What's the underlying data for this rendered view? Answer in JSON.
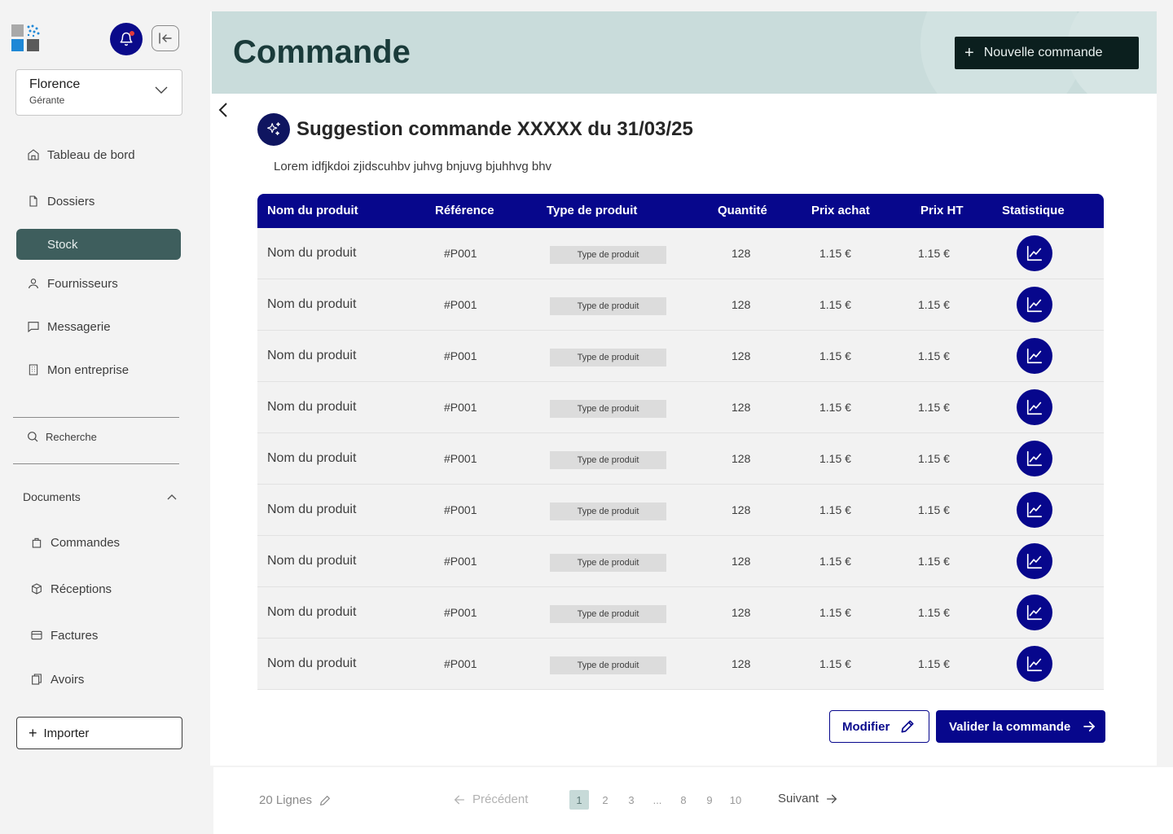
{
  "sidebar": {
    "user": {
      "name": "Florence",
      "role": "Gérante"
    },
    "nav": [
      {
        "label": "Tableau de bord",
        "icon": "home-icon"
      },
      {
        "label": "Dossiers",
        "icon": "file-icon"
      },
      {
        "label": "Stock",
        "icon": "stock-icon"
      },
      {
        "label": "Fournisseurs",
        "icon": "user-icon"
      },
      {
        "label": "Messagerie",
        "icon": "message-icon"
      },
      {
        "label": "Mon entreprise",
        "icon": "building-icon"
      }
    ],
    "active_index": 2,
    "search_label": "Recherche",
    "documents": {
      "label": "Documents",
      "items": [
        {
          "label": "Commandes",
          "icon": "bag-icon"
        },
        {
          "label": "Réceptions",
          "icon": "package-icon"
        },
        {
          "label": "Factures",
          "icon": "invoice-icon"
        },
        {
          "label": "Avoirs",
          "icon": "credit-note-icon"
        }
      ]
    },
    "import_label": "Importer"
  },
  "header": {
    "title": "Commande",
    "new_order_label": "Nouvelle commande"
  },
  "suggestion": {
    "title": "Suggestion commande XXXXX du 31/03/25",
    "description": "Lorem idfjkdoi zjidscuhbv juhvg bnjuvg bjuhhvg bhv"
  },
  "table": {
    "columns": [
      "Nom du produit",
      "Référence",
      "Type de produit",
      "Quantité",
      "Prix achat",
      "Prix HT",
      "Statistique"
    ],
    "rows": [
      {
        "name": "Nom du produit",
        "ref": "#P001",
        "type": "Type de produit",
        "qty": "128",
        "prix_achat": "1.15 €",
        "prix_ht": "1.15 €"
      },
      {
        "name": "Nom du produit",
        "ref": "#P001",
        "type": "Type de produit",
        "qty": "128",
        "prix_achat": "1.15 €",
        "prix_ht": "1.15 €"
      },
      {
        "name": "Nom du produit",
        "ref": "#P001",
        "type": "Type de produit",
        "qty": "128",
        "prix_achat": "1.15 €",
        "prix_ht": "1.15 €"
      },
      {
        "name": "Nom du produit",
        "ref": "#P001",
        "type": "Type de produit",
        "qty": "128",
        "prix_achat": "1.15 €",
        "prix_ht": "1.15 €"
      },
      {
        "name": "Nom du produit",
        "ref": "#P001",
        "type": "Type de produit",
        "qty": "128",
        "prix_achat": "1.15 €",
        "prix_ht": "1.15 €"
      },
      {
        "name": "Nom du produit",
        "ref": "#P001",
        "type": "Type de produit",
        "qty": "128",
        "prix_achat": "1.15 €",
        "prix_ht": "1.15 €"
      },
      {
        "name": "Nom du produit",
        "ref": "#P001",
        "type": "Type de produit",
        "qty": "128",
        "prix_achat": "1.15 €",
        "prix_ht": "1.15 €"
      },
      {
        "name": "Nom du produit",
        "ref": "#P001",
        "type": "Type de produit",
        "qty": "128",
        "prix_achat": "1.15 €",
        "prix_ht": "1.15 €"
      },
      {
        "name": "Nom du produit",
        "ref": "#P001",
        "type": "Type de produit",
        "qty": "128",
        "prix_achat": "1.15 €",
        "prix_ht": "1.15 €"
      }
    ]
  },
  "actions": {
    "modify_label": "Modifier",
    "validate_label": "Valider la commande"
  },
  "pagination": {
    "lines_label": "20 Lignes",
    "prev_label": "Précédent",
    "next_label": "Suivant",
    "pages": [
      "1",
      "2",
      "3",
      "...",
      "8",
      "9",
      "10"
    ],
    "current": "1"
  },
  "colors": {
    "primary": "#07078c",
    "sidebar_active": "#3e5e5d",
    "header_bg": "#c9dcdb",
    "new_order_bg": "#0b1f1e"
  }
}
